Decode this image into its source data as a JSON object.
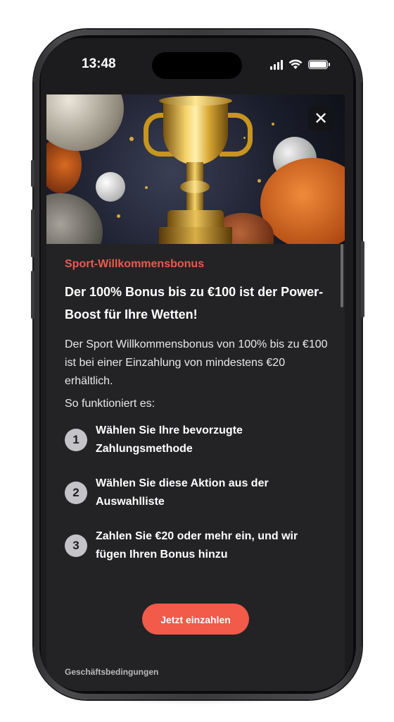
{
  "status_bar": {
    "time": "13:48",
    "icons": [
      "signal-icon",
      "wifi-icon",
      "battery-icon"
    ]
  },
  "hero": {
    "image": "trophy-with-sports-balls",
    "close_icon": "close-icon"
  },
  "promo": {
    "eyebrow": "Sport-Willkommensbonus",
    "headline": "Der 100% Bonus bis zu €100 ist der Power-Boost für Ihre Wetten!",
    "description": "Der Sport Willkommensbonus von 100% bis zu €100 ist bei einer Einzahlung von mindestens €20 erhältlich.",
    "howto": "So funktioniert es:",
    "steps": [
      {
        "num": "1",
        "text": "Wählen Sie Ihre bevorzugte Zahlungsmethode"
      },
      {
        "num": "2",
        "text": "Wählen Sie diese Aktion aus der Auswahlliste"
      },
      {
        "num": "3",
        "text": "Zahlen Sie €20 oder mehr ein, und wir fügen Ihren Bonus hinzu"
      }
    ],
    "cta_label": "Jetzt einzahlen",
    "terms_label": "Geschäftsbedingungen"
  },
  "colors": {
    "accent": "#f25a4a",
    "eyebrow": "#ec5a4c",
    "background": "#232325"
  }
}
